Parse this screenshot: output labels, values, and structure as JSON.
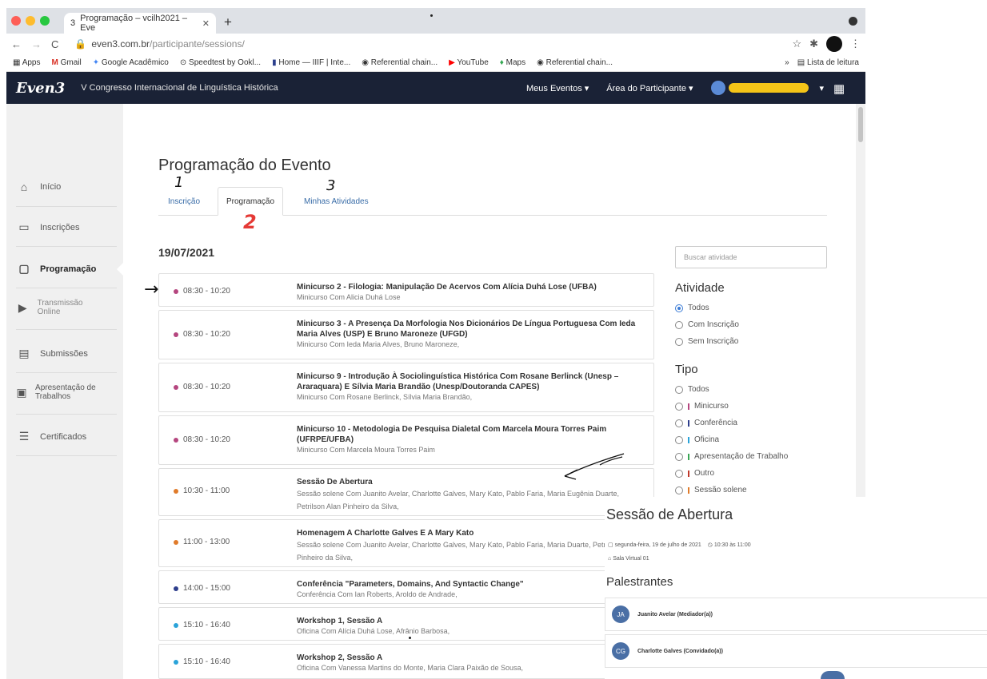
{
  "browser": {
    "tab_title": "Programação – vcilh2021 – Eve",
    "tab_count": "3",
    "url_host": "even3.com.br",
    "url_path": "/participante/sessions/",
    "bookmarks": [
      "Apps",
      "Gmail",
      "Google Acadêmico",
      "Speedtest by Ookl...",
      "Home — IIIF | Inte...",
      "Referential chain...",
      "YouTube",
      "Maps",
      "Referential chain..."
    ],
    "reading_list": "Lista de leitura",
    "more_bookmarks": "»",
    "traffic_colors": [
      "#fe5f57",
      "#febc2e",
      "#28c840"
    ]
  },
  "navbar": {
    "logo": "Even3",
    "event_name": "V Congresso Internacional de Linguística Histórica",
    "my_events": "Meus Eventos ▾",
    "participant_area": "Área do Participante ▾",
    "user_caret": "▾",
    "bg_color": "#1a2236"
  },
  "sidebar": {
    "items": [
      {
        "label": "Início",
        "icon": "home-icon"
      },
      {
        "label": "Inscrições",
        "icon": "ticket-icon"
      },
      {
        "label": "Programação",
        "icon": "calendar-icon"
      },
      {
        "label": "Transmissão Online",
        "icon": "play-icon"
      },
      {
        "label": "Submissões",
        "icon": "document-icon"
      },
      {
        "label": "Apresentação de Trabalhos",
        "icon": "presentation-icon"
      },
      {
        "label": "Certificados",
        "icon": "list-icon"
      }
    ]
  },
  "page": {
    "title": "Programação do Evento",
    "tabs": [
      "Inscrição",
      "Programação",
      "Minhas Atividades"
    ],
    "annotations": [
      "1",
      "2",
      "3",
      "→"
    ],
    "date": "19/07/2021"
  },
  "sessions": [
    {
      "time": "08:30 - 10:20",
      "color": "#b5467f",
      "title": "Minicurso 2 - Filologia: Manipulação De Acervos Com Alícia Duhá Lose (UFBA)",
      "subtitle": "Minicurso Com Alicia Duhá Lose"
    },
    {
      "time": "08:30 - 10:20",
      "color": "#b5467f",
      "title": "Minicurso 3 - A Presença Da Morfologia Nos Dicionários De Língua Portuguesa Com Ieda Maria Alves (USP) E Bruno Maroneze (UFGD)",
      "subtitle": "Minicurso Com Ieda Maria Alves, Bruno Maroneze,"
    },
    {
      "time": "08:30 - 10:20",
      "color": "#b5467f",
      "title": "Minicurso 9 - Introdução À Sociolinguística Histórica Com Rosane Berlinck (Unesp – Araraquara) E Sílvia Maria Brandão (Unesp/Doutoranda CAPES)",
      "subtitle": "Minicurso Com Rosane Berlinck, Sílvia Maria Brandão,"
    },
    {
      "time": "08:30 - 10:20",
      "color": "#b5467f",
      "title": "Minicurso 10 - Metodologia De Pesquisa Dialetal Com Marcela Moura Torres Paim (UFRPE/UFBA)",
      "subtitle": "Minicurso Com Marcela Moura Torres Paim"
    },
    {
      "time": "10:30 - 11:00",
      "color": "#e07b2a",
      "title": "Sessão De Abertura",
      "subtitle": "Sessão solene Com Juanito Avelar, Charlotte Galves, Mary Kato, Pablo Faria, Maria Eugênia Duarte, Petrilson Alan Pinheiro da Silva,"
    },
    {
      "time": "11:00 - 13:00",
      "color": "#e07b2a",
      "title": "Homenagem A Charlotte Galves E A Mary Kato",
      "subtitle": "Sessão solene Com Juanito Avelar, Charlotte Galves, Mary Kato, Pablo Faria, Maria Duarte, Petrilson Alan Pinheiro da Silva,"
    },
    {
      "time": "14:00 - 15:00",
      "color": "#2e3e8c",
      "title": "Conferência \"Parameters, Domains, And Syntactic Change\"",
      "subtitle": "Conferência Com Ian Roberts, Aroldo de Andrade,"
    },
    {
      "time": "15:10 - 16:40",
      "color": "#2aa3d9",
      "title": "Workshop 1, Sessão A",
      "subtitle": "Oficina Com Alícia Duhá Lose, Afrânio Barbosa,"
    },
    {
      "time": "15:10 - 16:40",
      "color": "#2aa3d9",
      "title": "Workshop 2, Sessão A",
      "subtitle": "Oficina Com Vanessa Martins do Monte, Maria Clara Paixão de Sousa,"
    }
  ],
  "filters": {
    "search_placeholder": "Buscar atividade",
    "activity_heading": "Atividade",
    "activity_options": [
      "Todos",
      "Com Inscrição",
      "Sem Inscrição"
    ],
    "type_heading": "Tipo",
    "type_options": [
      {
        "label": "Todos"
      },
      {
        "label": "Minicurso",
        "color": "#b5467f"
      },
      {
        "label": "Conferência",
        "color": "#2e3e8c"
      },
      {
        "label": "Oficina",
        "color": "#2aa3d9"
      },
      {
        "label": "Apresentação de Trabalho",
        "color": "#3aa655"
      },
      {
        "label": "Outro",
        "color": "#c0392b"
      },
      {
        "label": "Sessão solene",
        "color": "#e07b2a"
      }
    ]
  },
  "popup": {
    "title": "Sessão de Abertura",
    "date": "segunda-feira, 19 de julho de 2021",
    "time": "10:30 às 11:00",
    "place": "Sala Virtual 01",
    "speakers_heading": "Palestrantes",
    "speakers": [
      {
        "initials": "JA",
        "name": "Juanito Avelar (Mediador(a))"
      },
      {
        "initials": "CG",
        "name": "Charlotte Galves (Convidado(a))"
      }
    ]
  }
}
